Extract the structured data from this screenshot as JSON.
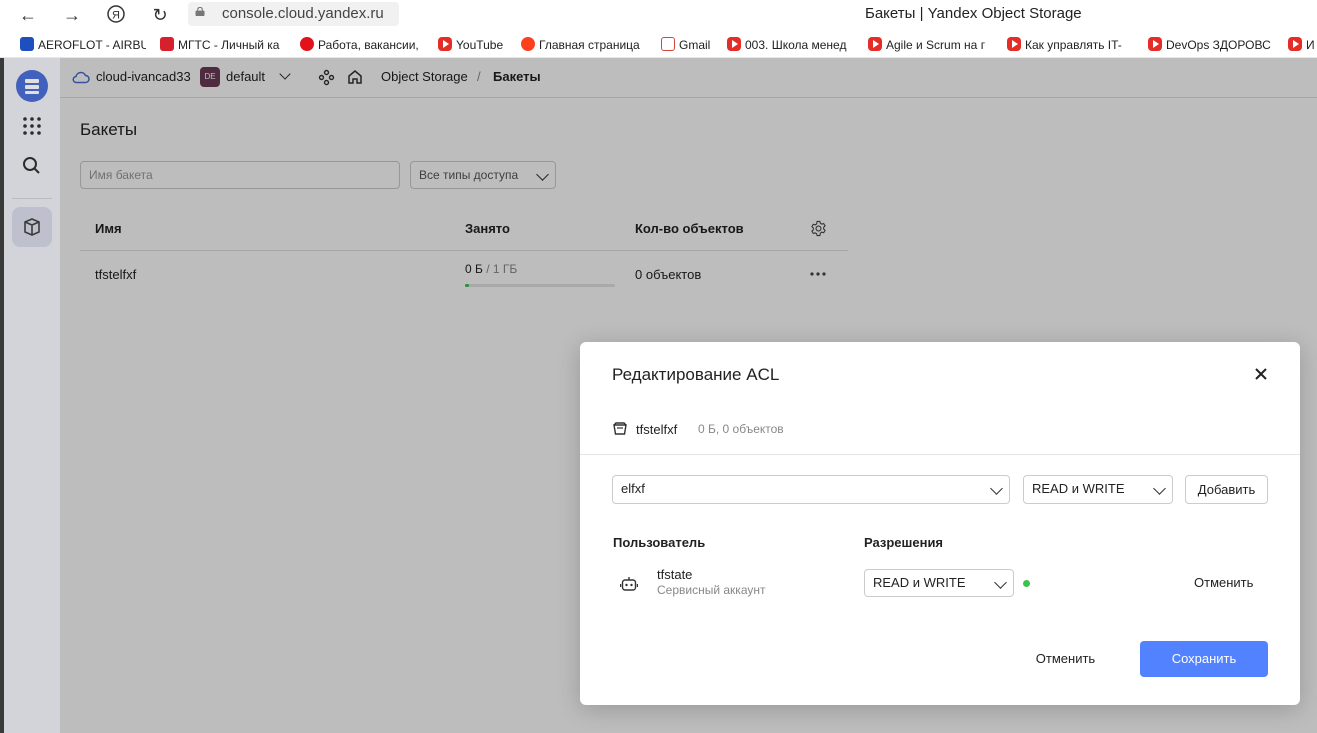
{
  "browser": {
    "url": "console.cloud.yandex.ru",
    "window_title": "Бакеты | Yandex Object Storage",
    "bookmarks": [
      {
        "label": "AEROFLOT - AIRBU",
        "icon": "aeroflot-icon",
        "color": "#1e4fbf"
      },
      {
        "label": "МГТС - Личный ка",
        "icon": "mgts-icon",
        "color": "#d6202b"
      },
      {
        "label": "Работа, вакансии,",
        "icon": "hh-icon",
        "color": "#e3111b"
      },
      {
        "label": "YouTube",
        "icon": "youtube-icon",
        "color": "#e52d27"
      },
      {
        "label": "Главная страница",
        "icon": "yandex-icon",
        "color": "#fc3f1d"
      },
      {
        "label": "Gmail",
        "icon": "gmail-icon",
        "color": "#d44638"
      },
      {
        "label": "003. Школа менед",
        "icon": "youtube-icon",
        "color": "#e52d27"
      },
      {
        "label": "Agile и Scrum на г",
        "icon": "youtube-icon",
        "color": "#e52d27"
      },
      {
        "label": "Как управлять IT-",
        "icon": "youtube-icon",
        "color": "#e52d27"
      },
      {
        "label": "DevOps ЗДОРОВС",
        "icon": "youtube-icon",
        "color": "#e52d27"
      },
      {
        "label": "И",
        "icon": "youtube-icon",
        "color": "#e52d27"
      }
    ]
  },
  "header": {
    "cloud": "cloud-ivancad33",
    "folder_badge": "DE",
    "folder": "default",
    "breadcrumb_service": "Object Storage",
    "breadcrumb_sep": "/",
    "breadcrumb_current": "Бакеты"
  },
  "page": {
    "title": "Бакеты",
    "search_placeholder": "Имя бакета",
    "access_filter": "Все типы доступа",
    "table": {
      "columns": [
        "Имя",
        "Занято",
        "Кол-во объектов"
      ],
      "rows": [
        {
          "name": "tfstelfxf",
          "used": "0 Б",
          "quota": "/ 1 ГБ",
          "usage_fraction": 0.0,
          "objects": "0 объектов"
        }
      ]
    }
  },
  "modal": {
    "title": "Редактирование ACL",
    "bucket_name": "tfstelfxf",
    "bucket_info": "0 Б, 0 объектов",
    "subject_value": "elfxf",
    "permission_value": "READ и WRITE",
    "add_label": "Добавить",
    "col_user": "Пользователь",
    "col_permissions": "Разрешения",
    "entries": [
      {
        "name": "tfstate",
        "type": "Сервисный аккаунт",
        "permission": "READ и WRITE",
        "revoke_label": "Отменить"
      }
    ],
    "cancel_label": "Отменить",
    "save_label": "Сохранить"
  },
  "colors": {
    "primary": "#5282ff",
    "status_green": "#3bc44b",
    "sidebar_active": "#4a6fd6",
    "folder_badge": "#6b3b55"
  }
}
